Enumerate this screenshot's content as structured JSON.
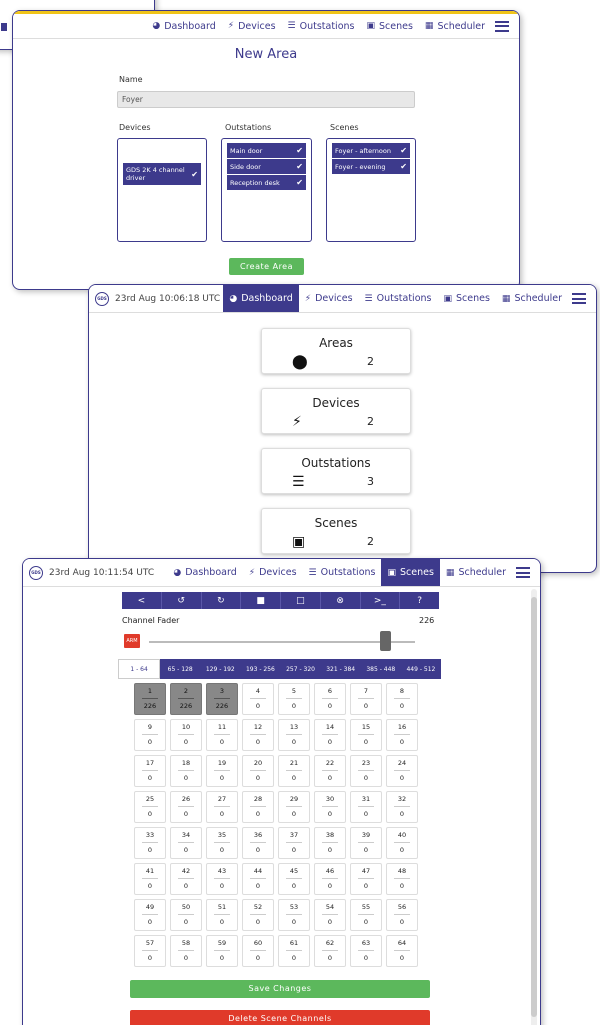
{
  "nav": {
    "dashboard": "Dashboard",
    "devices": "Devices",
    "outstations": "Outstations",
    "scenes": "Scenes",
    "scheduler": "Scheduler",
    "brand_logo": "GDS"
  },
  "new_area": {
    "title": "New Area",
    "name_label": "Name",
    "name_value": "Foyer",
    "devices_label": "Devices",
    "outstations_label": "Outstations",
    "scenes_label": "Scenes",
    "devices": [
      "GDS 2K 4 channel driver"
    ],
    "outstations": [
      "Main door",
      "Side door",
      "Reception desk"
    ],
    "scenes": [
      "Foyer - afternoon",
      "Foyer - evening"
    ],
    "create_button": "Create Area"
  },
  "dashboard": {
    "timestamp": "23rd Aug 10:06:18 UTC",
    "cards": [
      {
        "title": "Areas",
        "count": "2",
        "icon": "map-marker-icon"
      },
      {
        "title": "Devices",
        "count": "2",
        "icon": "plug-icon"
      },
      {
        "title": "Outstations",
        "count": "3",
        "icon": "sliders-icon"
      },
      {
        "title": "Scenes",
        "count": "2",
        "icon": "image-icon"
      }
    ]
  },
  "fader_window": {
    "timestamp": "23rd Aug 10:11:54 UTC",
    "toolbar": [
      "<",
      "↺",
      "↻",
      "■",
      "□",
      "⊗",
      ">_",
      "?"
    ],
    "fader_label": "Channel Fader",
    "fader_value": "226",
    "fader_level_fraction": 0.886,
    "arm_label": "ARM",
    "ranges": [
      "1 - 64",
      "65 - 128",
      "129 - 192",
      "193 - 256",
      "257 - 320",
      "321 - 384",
      "385 - 448",
      "449 - 512"
    ],
    "active_range": 0,
    "channels": [
      {
        "n": "1",
        "v": "226",
        "sel": true
      },
      {
        "n": "2",
        "v": "226",
        "sel": true
      },
      {
        "n": "3",
        "v": "226",
        "sel": true
      },
      {
        "n": "4",
        "v": "0"
      },
      {
        "n": "5",
        "v": "0"
      },
      {
        "n": "6",
        "v": "0"
      },
      {
        "n": "7",
        "v": "0"
      },
      {
        "n": "8",
        "v": "0"
      },
      {
        "n": "9",
        "v": "0"
      },
      {
        "n": "10",
        "v": "0"
      },
      {
        "n": "11",
        "v": "0"
      },
      {
        "n": "12",
        "v": "0"
      },
      {
        "n": "13",
        "v": "0"
      },
      {
        "n": "14",
        "v": "0"
      },
      {
        "n": "15",
        "v": "0"
      },
      {
        "n": "16",
        "v": "0"
      },
      {
        "n": "17",
        "v": "0"
      },
      {
        "n": "18",
        "v": "0"
      },
      {
        "n": "19",
        "v": "0"
      },
      {
        "n": "20",
        "v": "0"
      },
      {
        "n": "21",
        "v": "0"
      },
      {
        "n": "22",
        "v": "0"
      },
      {
        "n": "23",
        "v": "0"
      },
      {
        "n": "24",
        "v": "0"
      },
      {
        "n": "25",
        "v": "0"
      },
      {
        "n": "26",
        "v": "0"
      },
      {
        "n": "27",
        "v": "0"
      },
      {
        "n": "28",
        "v": "0"
      },
      {
        "n": "29",
        "v": "0"
      },
      {
        "n": "30",
        "v": "0"
      },
      {
        "n": "31",
        "v": "0"
      },
      {
        "n": "32",
        "v": "0"
      },
      {
        "n": "33",
        "v": "0"
      },
      {
        "n": "34",
        "v": "0"
      },
      {
        "n": "35",
        "v": "0"
      },
      {
        "n": "36",
        "v": "0"
      },
      {
        "n": "37",
        "v": "0"
      },
      {
        "n": "38",
        "v": "0"
      },
      {
        "n": "39",
        "v": "0"
      },
      {
        "n": "40",
        "v": "0"
      },
      {
        "n": "41",
        "v": "0"
      },
      {
        "n": "42",
        "v": "0"
      },
      {
        "n": "43",
        "v": "0"
      },
      {
        "n": "44",
        "v": "0"
      },
      {
        "n": "45",
        "v": "0"
      },
      {
        "n": "46",
        "v": "0"
      },
      {
        "n": "47",
        "v": "0"
      },
      {
        "n": "48",
        "v": "0"
      },
      {
        "n": "49",
        "v": "0"
      },
      {
        "n": "50",
        "v": "0"
      },
      {
        "n": "51",
        "v": "0"
      },
      {
        "n": "52",
        "v": "0"
      },
      {
        "n": "53",
        "v": "0"
      },
      {
        "n": "54",
        "v": "0"
      },
      {
        "n": "55",
        "v": "0"
      },
      {
        "n": "56",
        "v": "0"
      },
      {
        "n": "57",
        "v": "0"
      },
      {
        "n": "58",
        "v": "0"
      },
      {
        "n": "59",
        "v": "0"
      },
      {
        "n": "60",
        "v": "0"
      },
      {
        "n": "61",
        "v": "0"
      },
      {
        "n": "62",
        "v": "0"
      },
      {
        "n": "63",
        "v": "0"
      },
      {
        "n": "64",
        "v": "0"
      }
    ],
    "save_button": "Save Changes",
    "delete_button": "Delete Scene Channels"
  },
  "colors": {
    "primary": "#3d3a8c",
    "success": "#5cb85c",
    "danger": "#e03a2a",
    "accent": "#f0c419"
  }
}
